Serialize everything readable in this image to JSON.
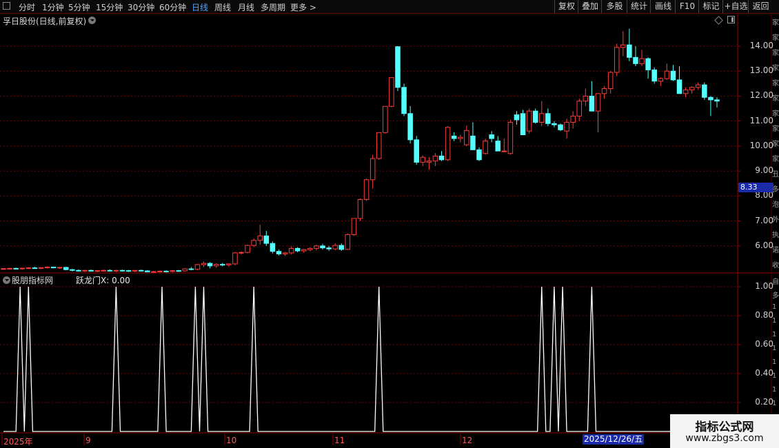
{
  "toolbar": {
    "periods": [
      "分时",
      "1分钟",
      "5分钟",
      "15分钟",
      "30分钟",
      "60分钟",
      "日线",
      "周线",
      "月线",
      "多周期",
      "更多 >"
    ],
    "active_period": "日线",
    "right_buttons": [
      "复权",
      "叠加",
      "多股",
      "统计",
      "画线",
      "F10",
      "标记",
      "+自选",
      "返回"
    ]
  },
  "stock": {
    "title": "孚日股份(日线,前复权)"
  },
  "price_axis": {
    "ticks": [
      "14.00",
      "13.00",
      "12.00",
      "11.00",
      "10.00",
      "9.00",
      "8.00",
      "7.00",
      "6.00"
    ],
    "current_price": "8.33"
  },
  "indicator": {
    "title": "股朋指标网",
    "value_text": "跃龙门X: 0.00",
    "ticks": [
      "1.00",
      "0.80",
      "0.60",
      "0.40",
      "0.20"
    ]
  },
  "x_axis": {
    "labels": [
      "2025年",
      "9",
      "10",
      "11",
      "12"
    ],
    "selected_date": "2025/12/26/五"
  },
  "watermark": {
    "line1": "指标公式网",
    "line2": "www.zbgs3.com"
  },
  "colors": {
    "up": "#ff3c3c",
    "down": "#54ffff",
    "grid": "#7a0000",
    "indicator_line": "#ffffff"
  },
  "side_glyphs": [
    "家",
    "家",
    "家",
    "家",
    "家",
    "家",
    "家",
    "家",
    "家",
    "家",
    "丑",
    "多",
    "泡",
    "外",
    "执",
    "诺",
    "收"
  ],
  "side_glyphs2": [
    "自",
    "多",
    "1",
    "1",
    "1",
    "1",
    "1",
    "1",
    "1",
    "1"
  ],
  "chart_data": [
    {
      "type": "candlestick",
      "title": "孚日股份(日线,前复权)",
      "ylim": [
        5.0,
        14.8
      ],
      "series": [
        {
          "name": "",
          "ohlc": [
            [
              5.08,
              5.11,
              5.05,
              5.09
            ],
            [
              5.09,
              5.12,
              5.06,
              5.1
            ],
            [
              5.1,
              5.13,
              5.07,
              5.08
            ],
            [
              5.08,
              5.12,
              5.05,
              5.11
            ],
            [
              5.11,
              5.15,
              5.08,
              5.12
            ],
            [
              5.12,
              5.16,
              5.09,
              5.1
            ],
            [
              5.1,
              5.14,
              5.07,
              5.13
            ],
            [
              5.13,
              5.18,
              5.1,
              5.15
            ],
            [
              5.15,
              5.17,
              5.1,
              5.12
            ],
            [
              5.12,
              5.16,
              5.08,
              5.14
            ],
            [
              5.14,
              5.16,
              5.02,
              5.05
            ],
            [
              5.05,
              5.08,
              4.98,
              5.02
            ],
            [
              5.02,
              5.06,
              4.97,
              5.0
            ],
            [
              5.0,
              5.04,
              4.96,
              5.02
            ],
            [
              5.02,
              5.05,
              4.97,
              4.99
            ],
            [
              4.99,
              5.03,
              4.95,
              5.01
            ],
            [
              5.01,
              5.05,
              4.97,
              5.02
            ],
            [
              5.02,
              5.06,
              4.98,
              5.0
            ],
            [
              5.0,
              5.04,
              4.95,
              5.02
            ],
            [
              5.02,
              5.05,
              4.97,
              5.01
            ],
            [
              5.01,
              5.04,
              4.96,
              4.99
            ],
            [
              4.99,
              5.03,
              4.95,
              5.02
            ],
            [
              5.02,
              5.05,
              4.97,
              5.0
            ],
            [
              5.0,
              5.03,
              4.94,
              4.96
            ],
            [
              4.96,
              5.0,
              4.92,
              4.97
            ],
            [
              4.97,
              5.01,
              4.93,
              4.99
            ],
            [
              4.99,
              5.02,
              4.94,
              4.98
            ],
            [
              4.98,
              5.03,
              4.94,
              5.01
            ],
            [
              5.01,
              5.04,
              4.96,
              5.0
            ],
            [
              5.0,
              5.1,
              4.97,
              5.08
            ],
            [
              5.08,
              5.15,
              5.02,
              5.06
            ],
            [
              5.06,
              5.28,
              5.02,
              5.25
            ],
            [
              5.25,
              5.38,
              5.15,
              5.3
            ],
            [
              5.3,
              5.35,
              5.1,
              5.2
            ],
            [
              5.2,
              5.3,
              5.12,
              5.26
            ],
            [
              5.26,
              5.32,
              5.18,
              5.24
            ],
            [
              5.24,
              5.3,
              5.16,
              5.28
            ],
            [
              5.28,
              5.75,
              5.22,
              5.72
            ],
            [
              5.72,
              5.78,
              5.66,
              5.74
            ],
            [
              5.74,
              6.05,
              5.7,
              6.02
            ],
            [
              6.02,
              6.3,
              5.95,
              6.22
            ],
            [
              6.22,
              6.85,
              6.05,
              6.4
            ],
            [
              6.4,
              6.6,
              6.0,
              6.1
            ],
            [
              6.1,
              6.18,
              5.7,
              5.78
            ],
            [
              5.78,
              5.85,
              5.62,
              5.68
            ],
            [
              5.68,
              5.76,
              5.6,
              5.72
            ],
            [
              5.72,
              5.98,
              5.65,
              5.9
            ],
            [
              5.9,
              5.95,
              5.74,
              5.8
            ],
            [
              5.8,
              5.88,
              5.72,
              5.85
            ],
            [
              5.85,
              5.95,
              5.78,
              5.9
            ],
            [
              5.9,
              6.05,
              5.82,
              6.0
            ],
            [
              6.0,
              6.08,
              5.85,
              5.92
            ],
            [
              5.92,
              6.0,
              5.8,
              5.88
            ],
            [
              5.88,
              6.1,
              5.82,
              6.02
            ],
            [
              6.02,
              6.1,
              5.8,
              5.86
            ],
            [
              5.86,
              6.5,
              5.84,
              6.45
            ],
            [
              6.45,
              7.1,
              6.4,
              7.1
            ],
            [
              7.1,
              7.9,
              7.0,
              7.86
            ],
            [
              7.86,
              8.7,
              7.8,
              8.65
            ],
            [
              8.65,
              9.65,
              8.3,
              9.5
            ],
            [
              9.5,
              10.54,
              9.45,
              10.54
            ],
            [
              10.54,
              11.59,
              10.5,
              11.59
            ],
            [
              11.59,
              12.74,
              11.55,
              12.74
            ],
            [
              13.98,
              14.0,
              12.2,
              12.35
            ],
            [
              12.35,
              12.5,
              11.2,
              11.3
            ],
            [
              11.3,
              11.6,
              10.1,
              10.25
            ],
            [
              10.25,
              10.4,
              9.25,
              9.35
            ],
            [
              9.35,
              9.62,
              9.2,
              9.55
            ],
            [
              9.35,
              9.55,
              9.05,
              9.4
            ],
            [
              9.4,
              9.72,
              9.2,
              9.6
            ],
            [
              9.6,
              9.8,
              9.4,
              9.45
            ],
            [
              9.45,
              10.8,
              9.4,
              10.75
            ],
            [
              10.4,
              10.55,
              10.2,
              10.3
            ],
            [
              10.3,
              10.45,
              10.15,
              10.35
            ],
            [
              10.05,
              10.82,
              10.0,
              10.62
            ],
            [
              10.4,
              10.95,
              10.1,
              9.85
            ],
            [
              9.85,
              9.95,
              9.4,
              9.45
            ],
            [
              9.7,
              10.3,
              9.65,
              10.2
            ],
            [
              10.45,
              10.6,
              10.15,
              10.3
            ],
            [
              10.2,
              10.4,
              9.8,
              9.8
            ],
            [
              9.8,
              10.3,
              9.75,
              9.8
            ],
            [
              9.7,
              11.05,
              9.65,
              10.95
            ],
            [
              11.25,
              11.4,
              10.85,
              11.05
            ],
            [
              11.3,
              11.45,
              10.6,
              10.45
            ],
            [
              10.6,
              11.5,
              10.5,
              11.4
            ],
            [
              11.4,
              11.5,
              10.9,
              10.95
            ],
            [
              10.95,
              11.8,
              10.8,
              11.3
            ],
            [
              11.3,
              11.5,
              10.8,
              10.9
            ],
            [
              10.9,
              11.0,
              10.75,
              10.85
            ],
            [
              10.85,
              10.9,
              10.6,
              10.65
            ],
            [
              10.6,
              11.1,
              10.3,
              10.95
            ],
            [
              10.95,
              11.4,
              10.7,
              11.2
            ],
            [
              11.2,
              11.9,
              11.0,
              11.8
            ],
            [
              11.8,
              12.3,
              11.6,
              12.0
            ],
            [
              12.0,
              12.6,
              11.8,
              11.4
            ],
            [
              11.4,
              12.1,
              10.55,
              12.1
            ],
            [
              12.1,
              12.4,
              11.9,
              12.3
            ],
            [
              12.3,
              13.0,
              12.1,
              12.95
            ],
            [
              12.95,
              14.1,
              12.8,
              13.95
            ],
            [
              13.95,
              14.6,
              13.6,
              14.05
            ],
            [
              14.05,
              14.7,
              13.4,
              13.55
            ],
            [
              13.55,
              14.0,
              13.2,
              13.3
            ],
            [
              13.3,
              13.85,
              13.2,
              13.5
            ],
            [
              13.5,
              13.55,
              12.7,
              13.05
            ],
            [
              13.05,
              13.15,
              12.5,
              12.6
            ],
            [
              12.6,
              12.75,
              12.4,
              12.7
            ],
            [
              12.7,
              13.3,
              12.65,
              13.0
            ],
            [
              13.0,
              13.25,
              12.6,
              12.65
            ],
            [
              12.65,
              13.2,
              12.2,
              12.1
            ],
            [
              12.1,
              12.35,
              11.95,
              12.25
            ],
            [
              12.25,
              12.4,
              12.1,
              12.35
            ],
            [
              12.35,
              12.55,
              12.25,
              12.45
            ],
            [
              12.45,
              12.55,
              11.85,
              11.95
            ],
            [
              11.95,
              12.0,
              11.2,
              11.85
            ],
            [
              11.85,
              11.95,
              11.55,
              11.8
            ]
          ]
        }
      ]
    },
    {
      "type": "line",
      "title": "股朋指标网",
      "ylim": [
        0,
        1.05
      ],
      "series": [
        {
          "name": "跃龙门X",
          "values": [
            0,
            0,
            0,
            0,
            1,
            0,
            1,
            0,
            0,
            0,
            0,
            0,
            0,
            0,
            0,
            0,
            0,
            0,
            0,
            0,
            0,
            0,
            0,
            0,
            0,
            0,
            0,
            1,
            0,
            0,
            0,
            0,
            0,
            0,
            0,
            0,
            0,
            0,
            1,
            0,
            0,
            0,
            0,
            0,
            0,
            0,
            1,
            0,
            1,
            0,
            0,
            0,
            0,
            0,
            0,
            0,
            0,
            0,
            0,
            0,
            1,
            0,
            0,
            0,
            0,
            0,
            0,
            0,
            0,
            0,
            0,
            0,
            0,
            0,
            0,
            0,
            0,
            0,
            0,
            0,
            0,
            0,
            0,
            0,
            0,
            0,
            0,
            0,
            0,
            0,
            1,
            0,
            0,
            0,
            0,
            0,
            0,
            0,
            0,
            0,
            0,
            0,
            0,
            0,
            0,
            0,
            0,
            0,
            0,
            0,
            0,
            0,
            0,
            0,
            0,
            0,
            0,
            0,
            0,
            0,
            0,
            0,
            0,
            0,
            0,
            0,
            0,
            0,
            0,
            1,
            0,
            0,
            1,
            0,
            1,
            0,
            0,
            0,
            0,
            0,
            0,
            1,
            0,
            0,
            0,
            0,
            0,
            0,
            0,
            0,
            0,
            0,
            0,
            0,
            0,
            0,
            0,
            0,
            0,
            0,
            0,
            0,
            0,
            0,
            0,
            0,
            0,
            0,
            0,
            0,
            0,
            0
          ]
        }
      ]
    }
  ]
}
